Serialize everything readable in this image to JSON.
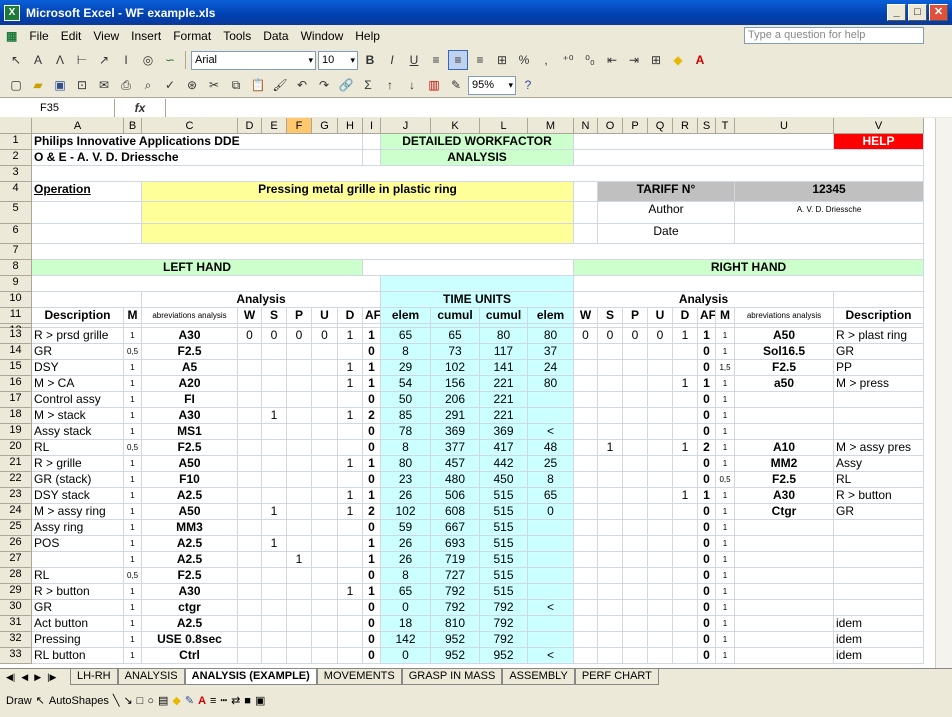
{
  "window": {
    "title": "Microsoft Excel - WF example.xls"
  },
  "menu": [
    "File",
    "Edit",
    "View",
    "Insert",
    "Format",
    "Tools",
    "Data",
    "Window",
    "Help"
  ],
  "help_placeholder": "Type a question for help",
  "toolbar": {
    "font": "Arial",
    "size": "10",
    "zoom": "95%"
  },
  "namebox": "F35",
  "formula_symbol": "fx",
  "columns": [
    "A",
    "B",
    "C",
    "D",
    "E",
    "F",
    "G",
    "H",
    "I",
    "J",
    "K",
    "L",
    "M",
    "N",
    "O",
    "P",
    "Q",
    "R",
    "S",
    "T",
    "U",
    "V"
  ],
  "header": {
    "company": "Philips Innovative Applications DDE",
    "dept": "O & E - A. V. D. Driessche",
    "title_line1": "DETAILED WORKFACTOR",
    "title_line2": "ANALYSIS",
    "help": "HELP",
    "operation_label": "Operation",
    "operation_value": "Pressing metal grille in plastic ring",
    "tariff_label": "TARIFF N°",
    "tariff_value": "12345",
    "author_label": "Author",
    "author_value": "A. V. D. Driessche",
    "date_label": "Date",
    "left_hand": "LEFT HAND",
    "right_hand": "RIGHT HAND",
    "time_units": "TIME UNITS",
    "analysis": "Analysis"
  },
  "subheaders": [
    "Description",
    "M",
    "abreviations analysis",
    "W",
    "S",
    "P",
    "U",
    "D",
    "AF",
    "elem",
    "cumul",
    "cumul",
    "elem",
    "W",
    "S",
    "P",
    "U",
    "D",
    "AF",
    "M",
    "abreviations analysis",
    "Description"
  ],
  "rows": [
    {
      "n": "13",
      "a": "R > prsd grille",
      "b": "1",
      "c": "A30",
      "d": "0",
      "e": "0",
      "f": "0",
      "g": "0",
      "h": "1",
      "i": "1",
      "j": "65",
      "k": "65",
      "l": "80",
      "m": "80",
      "n2": "0",
      "o": "0",
      "p": "0",
      "q": "0",
      "r": "1",
      "s": "1",
      "t": "1",
      "u": "A50",
      "v": "R > plast ring"
    },
    {
      "n": "14",
      "a": "GR",
      "b": "0,5",
      "c": "F2.5",
      "d": "",
      "e": "",
      "f": "",
      "g": "",
      "h": "",
      "i": "0",
      "j": "8",
      "k": "73",
      "l": "117",
      "m": "37",
      "n2": "",
      "o": "",
      "p": "",
      "q": "",
      "r": "",
      "s": "0",
      "t": "1",
      "u": "Sol16.5",
      "v": "GR"
    },
    {
      "n": "15",
      "a": "DSY",
      "b": "1",
      "c": "A5",
      "d": "",
      "e": "",
      "f": "",
      "g": "",
      "h": "1",
      "i": "1",
      "j": "29",
      "k": "102",
      "l": "141",
      "m": "24",
      "n2": "",
      "o": "",
      "p": "",
      "q": "",
      "r": "",
      "s": "0",
      "t": "1,5",
      "u": "F2.5",
      "v": "PP"
    },
    {
      "n": "16",
      "a": "M > CA",
      "b": "1",
      "c": "A20",
      "d": "",
      "e": "",
      "f": "",
      "g": "",
      "h": "1",
      "i": "1",
      "j": "54",
      "k": "156",
      "l": "221",
      "m": "80",
      "n2": "",
      "o": "",
      "p": "",
      "q": "",
      "r": "1",
      "s": "1",
      "t": "1",
      "u": "a50",
      "v": "M > press"
    },
    {
      "n": "17",
      "a": "Control assy",
      "b": "1",
      "c": "FI",
      "d": "",
      "e": "",
      "f": "",
      "g": "",
      "h": "",
      "i": "0",
      "j": "50",
      "k": "206",
      "l": "221",
      "m": "",
      "n2": "",
      "o": "",
      "p": "",
      "q": "",
      "r": "",
      "s": "0",
      "t": "1",
      "u": "",
      "v": ""
    },
    {
      "n": "18",
      "a": "M > stack",
      "b": "1",
      "c": "A30",
      "d": "",
      "e": "1",
      "f": "",
      "g": "",
      "h": "1",
      "i": "2",
      "j": "85",
      "k": "291",
      "l": "221",
      "m": "",
      "n2": "",
      "o": "",
      "p": "",
      "q": "",
      "r": "",
      "s": "0",
      "t": "1",
      "u": "",
      "v": ""
    },
    {
      "n": "19",
      "a": "Assy stack",
      "b": "1",
      "c": "MS1",
      "d": "",
      "e": "",
      "f": "",
      "g": "",
      "h": "",
      "i": "0",
      "j": "78",
      "k": "369",
      "l": "369",
      "m": "<",
      "n2": "",
      "o": "",
      "p": "",
      "q": "",
      "r": "",
      "s": "0",
      "t": "1",
      "u": "",
      "v": ""
    },
    {
      "n": "20",
      "a": "RL",
      "b": "0,5",
      "c": "F2.5",
      "d": "",
      "e": "",
      "f": "",
      "g": "",
      "h": "",
      "i": "0",
      "j": "8",
      "k": "377",
      "l": "417",
      "m": "48",
      "n2": "",
      "o": "1",
      "p": "",
      "q": "",
      "r": "1",
      "s": "2",
      "t": "1",
      "u": "A10",
      "v": "M > assy pres"
    },
    {
      "n": "21",
      "a": "R > grille",
      "b": "1",
      "c": "A50",
      "d": "",
      "e": "",
      "f": "",
      "g": "",
      "h": "1",
      "i": "1",
      "j": "80",
      "k": "457",
      "l": "442",
      "m": "25",
      "n2": "",
      "o": "",
      "p": "",
      "q": "",
      "r": "",
      "s": "0",
      "t": "1",
      "u": "MM2",
      "v": "Assy"
    },
    {
      "n": "22",
      "a": "GR (stack)",
      "b": "1",
      "c": "F10",
      "d": "",
      "e": "",
      "f": "",
      "g": "",
      "h": "",
      "i": "0",
      "j": "23",
      "k": "480",
      "l": "450",
      "m": "8",
      "n2": "",
      "o": "",
      "p": "",
      "q": "",
      "r": "",
      "s": "0",
      "t": "0,5",
      "u": "F2.5",
      "v": "RL"
    },
    {
      "n": "23",
      "a": "DSY stack",
      "b": "1",
      "c": "A2.5",
      "d": "",
      "e": "",
      "f": "",
      "g": "",
      "h": "1",
      "i": "1",
      "j": "26",
      "k": "506",
      "l": "515",
      "m": "65",
      "n2": "",
      "o": "",
      "p": "",
      "q": "",
      "r": "1",
      "s": "1",
      "t": "1",
      "u": "A30",
      "v": "R > button"
    },
    {
      "n": "24",
      "a": "M > assy ring",
      "b": "1",
      "c": "A50",
      "d": "",
      "e": "1",
      "f": "",
      "g": "",
      "h": "1",
      "i": "2",
      "j": "102",
      "k": "608",
      "l": "515",
      "m": "0",
      "n2": "",
      "o": "",
      "p": "",
      "q": "",
      "r": "",
      "s": "0",
      "t": "1",
      "u": "Ctgr",
      "v": "GR"
    },
    {
      "n": "25",
      "a": "Assy ring",
      "b": "1",
      "c": "MM3",
      "d": "",
      "e": "",
      "f": "",
      "g": "",
      "h": "",
      "i": "0",
      "j": "59",
      "k": "667",
      "l": "515",
      "m": "",
      "n2": "",
      "o": "",
      "p": "",
      "q": "",
      "r": "",
      "s": "0",
      "t": "1",
      "u": "",
      "v": ""
    },
    {
      "n": "26",
      "a": "POS",
      "b": "1",
      "c": "A2.5",
      "d": "",
      "e": "1",
      "f": "",
      "g": "",
      "h": "",
      "i": "1",
      "j": "26",
      "k": "693",
      "l": "515",
      "m": "",
      "n2": "",
      "o": "",
      "p": "",
      "q": "",
      "r": "",
      "s": "0",
      "t": "1",
      "u": "",
      "v": ""
    },
    {
      "n": "27",
      "a": "",
      "b": "1",
      "c": "A2.5",
      "d": "",
      "e": "",
      "f": "1",
      "g": "",
      "h": "",
      "i": "1",
      "j": "26",
      "k": "719",
      "l": "515",
      "m": "",
      "n2": "",
      "o": "",
      "p": "",
      "q": "",
      "r": "",
      "s": "0",
      "t": "1",
      "u": "",
      "v": ""
    },
    {
      "n": "28",
      "a": "RL",
      "b": "0,5",
      "c": "F2.5",
      "d": "",
      "e": "",
      "f": "",
      "g": "",
      "h": "",
      "i": "0",
      "j": "8",
      "k": "727",
      "l": "515",
      "m": "",
      "n2": "",
      "o": "",
      "p": "",
      "q": "",
      "r": "",
      "s": "0",
      "t": "1",
      "u": "",
      "v": ""
    },
    {
      "n": "29",
      "a": "R > button",
      "b": "1",
      "c": "A30",
      "d": "",
      "e": "",
      "f": "",
      "g": "",
      "h": "1",
      "i": "1",
      "j": "65",
      "k": "792",
      "l": "515",
      "m": "",
      "n2": "",
      "o": "",
      "p": "",
      "q": "",
      "r": "",
      "s": "0",
      "t": "1",
      "u": "",
      "v": ""
    },
    {
      "n": "30",
      "a": "GR",
      "b": "1",
      "c": "ctgr",
      "d": "",
      "e": "",
      "f": "",
      "g": "",
      "h": "",
      "i": "0",
      "j": "0",
      "k": "792",
      "l": "792",
      "m": "<",
      "n2": "",
      "o": "",
      "p": "",
      "q": "",
      "r": "",
      "s": "0",
      "t": "1",
      "u": "",
      "v": ""
    },
    {
      "n": "31",
      "a": "Act button",
      "b": "1",
      "c": "A2.5",
      "d": "",
      "e": "",
      "f": "",
      "g": "",
      "h": "",
      "i": "0",
      "j": "18",
      "k": "810",
      "l": "792",
      "m": "",
      "n2": "",
      "o": "",
      "p": "",
      "q": "",
      "r": "",
      "s": "0",
      "t": "1",
      "u": "",
      "v": "idem"
    },
    {
      "n": "32",
      "a": "Pressing",
      "b": "1",
      "c": "USE 0.8sec",
      "d": "",
      "e": "",
      "f": "",
      "g": "",
      "h": "",
      "i": "0",
      "j": "142",
      "k": "952",
      "l": "792",
      "m": "",
      "n2": "",
      "o": "",
      "p": "",
      "q": "",
      "r": "",
      "s": "0",
      "t": "1",
      "u": "",
      "v": "idem"
    },
    {
      "n": "33",
      "a": "RL button",
      "b": "1",
      "c": "Ctrl",
      "d": "",
      "e": "",
      "f": "",
      "g": "",
      "h": "",
      "i": "0",
      "j": "0",
      "k": "952",
      "l": "952",
      "m": "<",
      "n2": "",
      "o": "",
      "p": "",
      "q": "",
      "r": "",
      "s": "0",
      "t": "1",
      "u": "",
      "v": "idem"
    }
  ],
  "sheet_tabs": [
    "LH-RH",
    "ANALYSIS",
    "ANALYSIS (EXAMPLE)",
    "MOVEMENTS",
    "GRASP IN MASS",
    "ASSEMBLY",
    "PERF CHART"
  ],
  "active_tab": "ANALYSIS (EXAMPLE)",
  "drawbar": {
    "draw": "Draw",
    "autoshapes": "AutoShapes"
  }
}
